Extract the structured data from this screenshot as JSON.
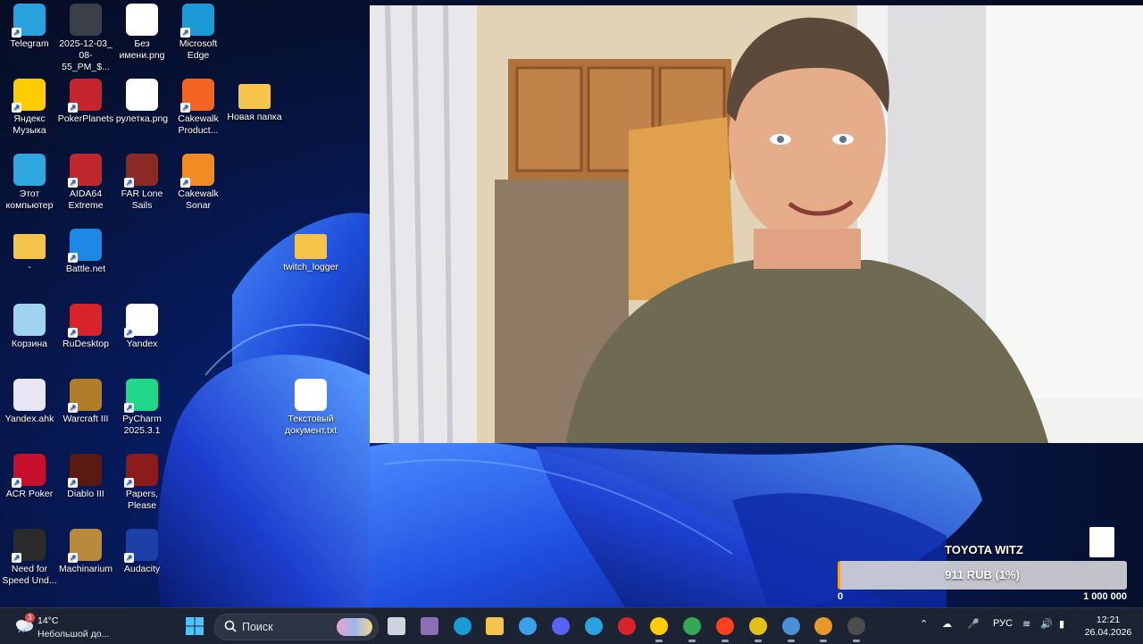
{
  "desktop": {
    "icons": [
      {
        "label": "Telegram",
        "icon": "telegram-icon",
        "color": "#2aa2de"
      },
      {
        "label": "2025-12-03_ 08-55_PM_$...",
        "icon": "image-file-icon",
        "color": "#3b3f4a"
      },
      {
        "label": "Без имени.png",
        "icon": "png-file-icon",
        "color": "#ffffff"
      },
      {
        "label": "Microsoft Edge",
        "icon": "edge-icon",
        "color": "#1b9ad6"
      },
      {
        "label": "Яндекс Музыка",
        "icon": "yandex-music-icon",
        "color": "#ffcc00"
      },
      {
        "label": "PokerPlanets",
        "icon": "pokerplanets-icon",
        "color": "#c4262e"
      },
      {
        "label": "рулетка.png",
        "icon": "png-file-icon",
        "color": "#ffffff"
      },
      {
        "label": "Cakewalk Product...",
        "icon": "cakewalk-icon",
        "color": "#f26522"
      },
      {
        "label": "Новая папка",
        "icon": "folder-icon",
        "color": "#f4c54a"
      },
      {
        "label": "Этот компьютер",
        "icon": "computer-icon",
        "color": "#2fa7e0"
      },
      {
        "label": "AIDA64 Extreme",
        "icon": "aida64-icon",
        "color": "#c0272d"
      },
      {
        "label": "FAR Lone Sails",
        "icon": "far-lone-sails-icon",
        "color": "#8b2a25"
      },
      {
        "label": "Cakewalk Sonar",
        "icon": "cakewalk-sonar-icon",
        "color": "#f28c22"
      },
      {
        "label": "-",
        "icon": "folder-icon",
        "color": "#f4c54a"
      },
      {
        "label": "Battle.net",
        "icon": "battlenet-icon",
        "color": "#1e88e5"
      },
      {
        "label": "twitch_logger",
        "icon": "folder-icon",
        "color": "#f4c54a"
      },
      {
        "label": "Корзина",
        "icon": "recycle-bin-icon",
        "color": "#9fd3f0"
      },
      {
        "label": "RuDesktop",
        "icon": "rudesktop-icon",
        "color": "#d8232a"
      },
      {
        "label": "Yandex",
        "icon": "yandex-browser-icon",
        "color": "#ffffff"
      },
      {
        "label": "Yandex.ahk",
        "icon": "ahk-file-icon",
        "color": "#e8e6f2"
      },
      {
        "label": "Warcraft III",
        "icon": "warcraft-icon",
        "color": "#b07d2b"
      },
      {
        "label": "PyCharm 2025.3.1",
        "icon": "pycharm-icon",
        "color": "#21d789"
      },
      {
        "label": "Текстовый документ.txt",
        "icon": "text-file-icon",
        "color": "#ffffff"
      },
      {
        "label": "ACR Poker",
        "icon": "acr-poker-icon",
        "color": "#c8102e"
      },
      {
        "label": "Diablo III",
        "icon": "diablo-icon",
        "color": "#5a1a10"
      },
      {
        "label": "Papers, Please",
        "icon": "papers-please-icon",
        "color": "#8c1b1b"
      },
      {
        "label": "Need for Speed Und...",
        "icon": "nfs-icon",
        "color": "#2b2b2b"
      },
      {
        "label": "Machinarium",
        "icon": "machinarium-icon",
        "color": "#b98a3e"
      },
      {
        "label": "Audacity",
        "icon": "audacity-icon",
        "color": "#1d3fa8"
      }
    ]
  },
  "donation": {
    "title": "TOYOTA WITZ",
    "amount": "911 RUB (1%)",
    "progress_fraction": 0.01,
    "min": "0",
    "max": "1 000 000",
    "bar_color": "#f59d1b"
  },
  "taskbar": {
    "weather": {
      "temp": "14°C",
      "condition": "Небольшой до...",
      "badge": "3"
    },
    "search_placeholder": "Поиск",
    "apps": [
      {
        "icon": "task-view-icon"
      },
      {
        "icon": "winrar-icon"
      },
      {
        "icon": "edge-icon"
      },
      {
        "icon": "file-explorer-icon"
      },
      {
        "icon": "cortana-icon"
      },
      {
        "icon": "discord-icon"
      },
      {
        "icon": "telegram-icon"
      },
      {
        "icon": "rudesktop-icon"
      },
      {
        "icon": "yandex-music-icon"
      },
      {
        "icon": "chrome-icon"
      },
      {
        "icon": "yandex-browser-icon"
      },
      {
        "icon": "keepass-icon"
      },
      {
        "icon": "chromium-icon"
      },
      {
        "icon": "pokerplanets-icon"
      },
      {
        "icon": "obs-icon"
      }
    ],
    "tray": {
      "language": "РУС",
      "time": "12:21",
      "date": "26.04.2026"
    }
  }
}
